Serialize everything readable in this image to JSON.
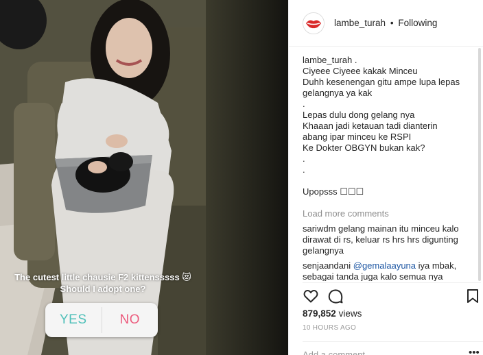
{
  "media": {
    "story_caption_line1": "The cutest little chausie F2 kittensssss 😻",
    "story_caption_line2": "Should I adopt one?",
    "poll_yes": "YES",
    "poll_no": "NO"
  },
  "post": {
    "username": "lambe_turah",
    "separator": "•",
    "follow_state": "Following"
  },
  "caption": {
    "username": "lambe_turah .",
    "lines": [
      "Ciyeee Ciyeee kakak Minceu",
      "Duhh kesenengan gitu ampe lupa lepas gelangnya ya kak",
      ".",
      "Lepas dulu dong gelang nya",
      "Khaaan jadi ketauan tadi dianterin abang ipar minceu ke RSPI",
      "Ke Dokter OBGYN bukan kak?",
      ".",
      ".",
      "Upopsss ☐☐☐"
    ]
  },
  "load_more_label": "Load more comments",
  "comments": [
    {
      "user": "sariwdm",
      "text": " gelang mainan itu minceu kalo dirawat di rs, keluar rs hrs hrs digunting gelangnya"
    },
    {
      "user": "senjaandani",
      "mention": "@gemalaayuna",
      "text": " iya mbak, sebagai tanda juga kalo semua nya udah"
    }
  ],
  "stats": {
    "views_count": "879,852",
    "views_label": " views",
    "time_ago": "10 HOURS AGO"
  },
  "add_comment_placeholder": "Add a comment…",
  "more_options_label": "•••",
  "icons": {
    "like": "heart-icon",
    "comment": "comment-icon",
    "save": "bookmark-icon"
  },
  "colors": {
    "poll_yes": "#4fc0b9",
    "poll_no": "#ec5b7d",
    "mention": "#1e57a3",
    "muted": "#8e8e8e"
  }
}
